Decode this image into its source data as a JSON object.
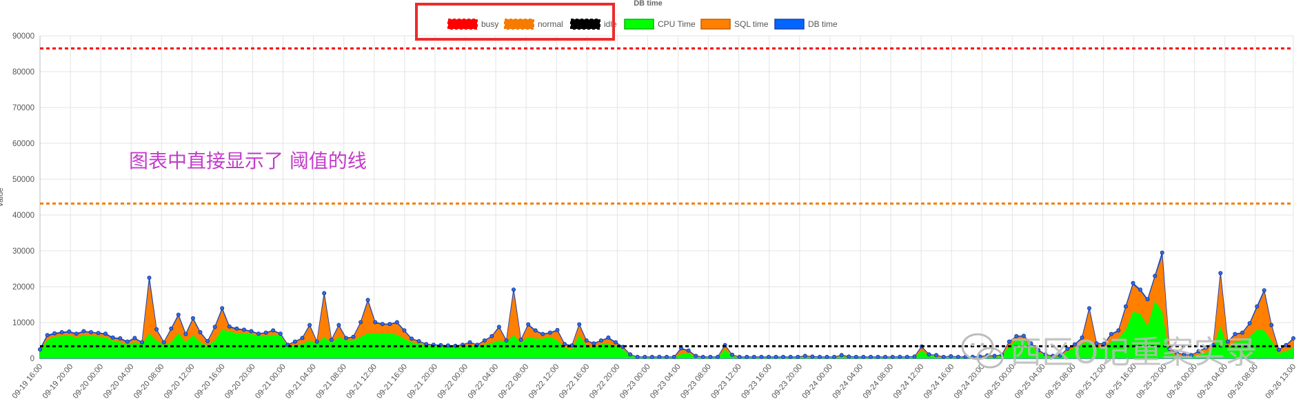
{
  "chart_data": {
    "type": "area",
    "title": "DB time",
    "ylabel": "value",
    "ylim": [
      0,
      90000
    ],
    "yticks": [
      0,
      10000,
      20000,
      30000,
      40000,
      50000,
      60000,
      70000,
      80000,
      90000
    ],
    "grid": true,
    "legend_position": "top",
    "x_tick_labels": [
      "09-19 16:00",
      "09-19 20:00",
      "09-20 00:00",
      "09-20 04:00",
      "09-20 08:00",
      "09-20 12:00",
      "09-20 16:00",
      "09-20 20:00",
      "09-21 00:00",
      "09-21 04:00",
      "09-21 08:00",
      "09-21 12:00",
      "09-21 16:00",
      "09-21 20:00",
      "09-22 00:00",
      "09-22 04:00",
      "09-22 08:00",
      "09-22 12:00",
      "09-22 16:00",
      "09-22 20:00",
      "09-23 00:00",
      "09-23 04:00",
      "09-23 08:00",
      "09-23 12:00",
      "09-23 16:00",
      "09-23 20:00",
      "09-24 00:00",
      "09-24 04:00",
      "09-24 08:00",
      "09-24 12:00",
      "09-24 16:00",
      "09-24 20:00",
      "09-25 00:00",
      "09-25 04:00",
      "09-25 08:00",
      "09-25 12:00",
      "09-25 16:00",
      "09-25 20:00",
      "09-26 00:00",
      "09-26 04:00",
      "09-26 08:00",
      "09-26 13:00"
    ],
    "x_range_hours": [
      0,
      165
    ],
    "thresholds": [
      {
        "name": "busy",
        "value": 86500,
        "color": "#ff0000"
      },
      {
        "name": "normal",
        "value": 43200,
        "color": "#f57c00"
      },
      {
        "name": "idle",
        "value": 3400,
        "color": "#000000"
      }
    ],
    "series": [
      {
        "name": "CPU Time",
        "color": "#00ff00"
      },
      {
        "name": "SQL time",
        "color": "#ff7f00"
      },
      {
        "name": "DB time",
        "color": "#0066ff"
      }
    ],
    "points": [
      [
        0,
        1800,
        2200,
        2500
      ],
      [
        1,
        5200,
        6100,
        6500
      ],
      [
        2,
        6000,
        6700,
        7000
      ],
      [
        3,
        6200,
        7000,
        7300
      ],
      [
        4,
        6500,
        7200,
        7500
      ],
      [
        5,
        5800,
        6600,
        6900
      ],
      [
        6,
        6400,
        7300,
        7600
      ],
      [
        7,
        6300,
        7100,
        7300
      ],
      [
        8,
        6100,
        6900,
        7100
      ],
      [
        9,
        5900,
        6600,
        6900
      ],
      [
        10,
        5000,
        5500,
        5800
      ],
      [
        11,
        4500,
        5300,
        5600
      ],
      [
        12,
        3800,
        4400,
        4700
      ],
      [
        13,
        4500,
        5400,
        5700
      ],
      [
        14,
        3900,
        4300,
        4500
      ],
      [
        15,
        7000,
        21500,
        22500
      ],
      [
        16,
        5000,
        7800,
        8100
      ],
      [
        17,
        3700,
        4300,
        4500
      ],
      [
        18,
        4500,
        8000,
        8300
      ],
      [
        19,
        7000,
        11800,
        12200
      ],
      [
        20,
        4500,
        6500,
        6800
      ],
      [
        21,
        6500,
        10800,
        11200
      ],
      [
        22,
        4500,
        7000,
        7300
      ],
      [
        23,
        3500,
        4600,
        4800
      ],
      [
        24,
        5000,
        8500,
        8800
      ],
      [
        25,
        8000,
        13500,
        14000
      ],
      [
        26,
        7500,
        8600,
        8900
      ],
      [
        27,
        7000,
        8000,
        8300
      ],
      [
        28,
        7000,
        7800,
        8000
      ],
      [
        29,
        6800,
        7400,
        7600
      ],
      [
        30,
        6300,
        6700,
        6900
      ],
      [
        31,
        6200,
        7000,
        7200
      ],
      [
        32,
        6600,
        7600,
        7800
      ],
      [
        33,
        6500,
        6700,
        6900
      ],
      [
        34,
        3500,
        3700,
        3800
      ],
      [
        35,
        3600,
        4500,
        4700
      ],
      [
        36,
        4000,
        5500,
        5700
      ],
      [
        37,
        5000,
        9000,
        9300
      ],
      [
        38,
        4000,
        4500,
        4700
      ],
      [
        39,
        6000,
        17500,
        18200
      ],
      [
        40,
        4300,
        5000,
        5200
      ],
      [
        41,
        6000,
        9000,
        9300
      ],
      [
        42,
        5000,
        5500,
        5700
      ],
      [
        43,
        5000,
        5800,
        6000
      ],
      [
        44,
        6000,
        9800,
        10100
      ],
      [
        45,
        7000,
        15800,
        16300
      ],
      [
        46,
        7000,
        9800,
        10100
      ],
      [
        47,
        6900,
        9400,
        9600
      ],
      [
        48,
        7000,
        9400,
        9600
      ],
      [
        49,
        6600,
        9800,
        10100
      ],
      [
        50,
        5500,
        7500,
        7800
      ],
      [
        51,
        4500,
        5300,
        5500
      ],
      [
        52,
        4000,
        4700,
        4800
      ],
      [
        53,
        3700,
        3900,
        4000
      ],
      [
        54,
        3500,
        3700,
        3800
      ],
      [
        55,
        3400,
        3600,
        3700
      ],
      [
        56,
        3300,
        3500,
        3600
      ],
      [
        57,
        3200,
        3400,
        3500
      ],
      [
        58,
        3400,
        3700,
        3800
      ],
      [
        59,
        3600,
        4300,
        4500
      ],
      [
        60,
        3500,
        3700,
        3800
      ],
      [
        61,
        3800,
        4800,
        5000
      ],
      [
        62,
        4300,
        6000,
        6200
      ],
      [
        63,
        5000,
        8500,
        8800
      ],
      [
        64,
        4500,
        4800,
        5000
      ],
      [
        65,
        6500,
        18500,
        19200
      ],
      [
        66,
        4300,
        5000,
        5200
      ],
      [
        67,
        6000,
        9200,
        9500
      ],
      [
        68,
        5500,
        7500,
        7800
      ],
      [
        69,
        5500,
        6600,
        6800
      ],
      [
        70,
        6000,
        7000,
        7200
      ],
      [
        71,
        5000,
        7600,
        7900
      ],
      [
        72,
        3000,
        3800,
        4000
      ],
      [
        73,
        2500,
        3500,
        3600
      ],
      [
        74,
        6500,
        9200,
        9500
      ],
      [
        75,
        3500,
        4800,
        5000
      ],
      [
        76,
        3000,
        4000,
        4200
      ],
      [
        77,
        4000,
        4800,
        5000
      ],
      [
        78,
        4000,
        5500,
        5800
      ],
      [
        79,
        3500,
        4200,
        4500
      ],
      [
        80,
        2500,
        3000,
        3200
      ],
      [
        81,
        800,
        1000,
        1100
      ],
      [
        82,
        300,
        350,
        400
      ],
      [
        83,
        200,
        300,
        400
      ],
      [
        84,
        200,
        300,
        400
      ],
      [
        85,
        250,
        350,
        450
      ],
      [
        86,
        200,
        300,
        400
      ],
      [
        87,
        200,
        300,
        400
      ],
      [
        88,
        1200,
        2500,
        2800
      ],
      [
        89,
        1500,
        2000,
        2200
      ],
      [
        90,
        400,
        600,
        700
      ],
      [
        91,
        200,
        300,
        400
      ],
      [
        92,
        200,
        300,
        400
      ],
      [
        93,
        200,
        300,
        400
      ],
      [
        94,
        2500,
        3500,
        3700
      ],
      [
        95,
        700,
        900,
        1000
      ],
      [
        96,
        200,
        300,
        400
      ],
      [
        97,
        200,
        300,
        400
      ],
      [
        98,
        200,
        300,
        400
      ],
      [
        99,
        200,
        300,
        400
      ],
      [
        100,
        200,
        300,
        400
      ],
      [
        101,
        200,
        300,
        400
      ],
      [
        102,
        200,
        300,
        400
      ],
      [
        103,
        200,
        300,
        400
      ],
      [
        104,
        200,
        300,
        400
      ],
      [
        105,
        400,
        600,
        700
      ],
      [
        106,
        300,
        400,
        500
      ],
      [
        107,
        200,
        300,
        400
      ],
      [
        108,
        200,
        300,
        400
      ],
      [
        109,
        200,
        300,
        400
      ],
      [
        110,
        600,
        800,
        900
      ],
      [
        111,
        300,
        400,
        500
      ],
      [
        112,
        200,
        300,
        400
      ],
      [
        113,
        200,
        300,
        400
      ],
      [
        114,
        200,
        300,
        400
      ],
      [
        115,
        200,
        300,
        400
      ],
      [
        116,
        200,
        300,
        400
      ],
      [
        117,
        200,
        300,
        400
      ],
      [
        118,
        250,
        350,
        450
      ],
      [
        119,
        200,
        300,
        400
      ],
      [
        120,
        300,
        400,
        500
      ],
      [
        121,
        2200,
        3100,
        3300
      ],
      [
        122,
        800,
        1000,
        1100
      ],
      [
        123,
        500,
        800,
        900
      ],
      [
        124,
        200,
        300,
        400
      ],
      [
        125,
        300,
        500,
        600
      ],
      [
        126,
        200,
        300,
        400
      ],
      [
        127,
        250,
        350,
        450
      ],
      [
        128,
        250,
        350,
        450
      ],
      [
        129,
        300,
        400,
        500
      ],
      [
        130,
        500,
        700,
        800
      ],
      [
        131,
        400,
        600,
        700
      ],
      [
        132,
        700,
        900,
        1000
      ],
      [
        133,
        3500,
        4500,
        4700
      ],
      [
        134,
        5000,
        6000,
        6200
      ],
      [
        135,
        5200,
        6100,
        6300
      ],
      [
        136,
        3500,
        4000,
        4200
      ],
      [
        137,
        1800,
        2100,
        2300
      ],
      [
        138,
        800,
        1000,
        1100
      ],
      [
        139,
        400,
        600,
        700
      ],
      [
        140,
        500,
        700,
        800
      ],
      [
        141,
        2000,
        2500,
        2700
      ],
      [
        142,
        3000,
        3700,
        3900
      ],
      [
        143,
        4000,
        5500,
        5800
      ],
      [
        144,
        5000,
        13500,
        14000
      ],
      [
        145,
        3000,
        4000,
        4200
      ],
      [
        146,
        3000,
        3900,
        4100
      ],
      [
        147,
        4500,
        6500,
        6800
      ],
      [
        148,
        5500,
        7500,
        7800
      ],
      [
        149,
        8000,
        14000,
        14500
      ],
      [
        150,
        13000,
        20500,
        21000
      ],
      [
        151,
        12500,
        18800,
        19200
      ],
      [
        152,
        9000,
        16000,
        16500
      ],
      [
        153,
        16000,
        22500,
        23000
      ],
      [
        154,
        13000,
        28500,
        29500
      ],
      [
        155,
        1500,
        2500,
        2700
      ],
      [
        156,
        800,
        1500,
        1600
      ],
      [
        157,
        500,
        1000,
        1100
      ],
      [
        158,
        400,
        800,
        900
      ],
      [
        159,
        1000,
        1800,
        2000
      ],
      [
        160,
        1500,
        2800,
        3000
      ],
      [
        161,
        3000,
        3500,
        3700
      ],
      [
        162,
        9000,
        23000,
        23800
      ],
      [
        163,
        3000,
        4500,
        4700
      ],
      [
        164,
        4500,
        6500,
        6800
      ],
      [
        165,
        5000,
        7000,
        7200
      ],
      [
        166,
        6000,
        9500,
        9800
      ],
      [
        167,
        8000,
        14000,
        14500
      ],
      [
        168,
        7800,
        18500,
        19000
      ],
      [
        169,
        5000,
        9000,
        9300
      ],
      [
        170,
        1500,
        2200,
        2400
      ],
      [
        171,
        2000,
        3500,
        3700
      ],
      [
        172,
        3000,
        5300,
        5600
      ]
    ]
  },
  "annotation": {
    "text": "图表中直接显示了 阈值的线"
  },
  "watermark": {
    "text": "西区O记重案实录"
  }
}
